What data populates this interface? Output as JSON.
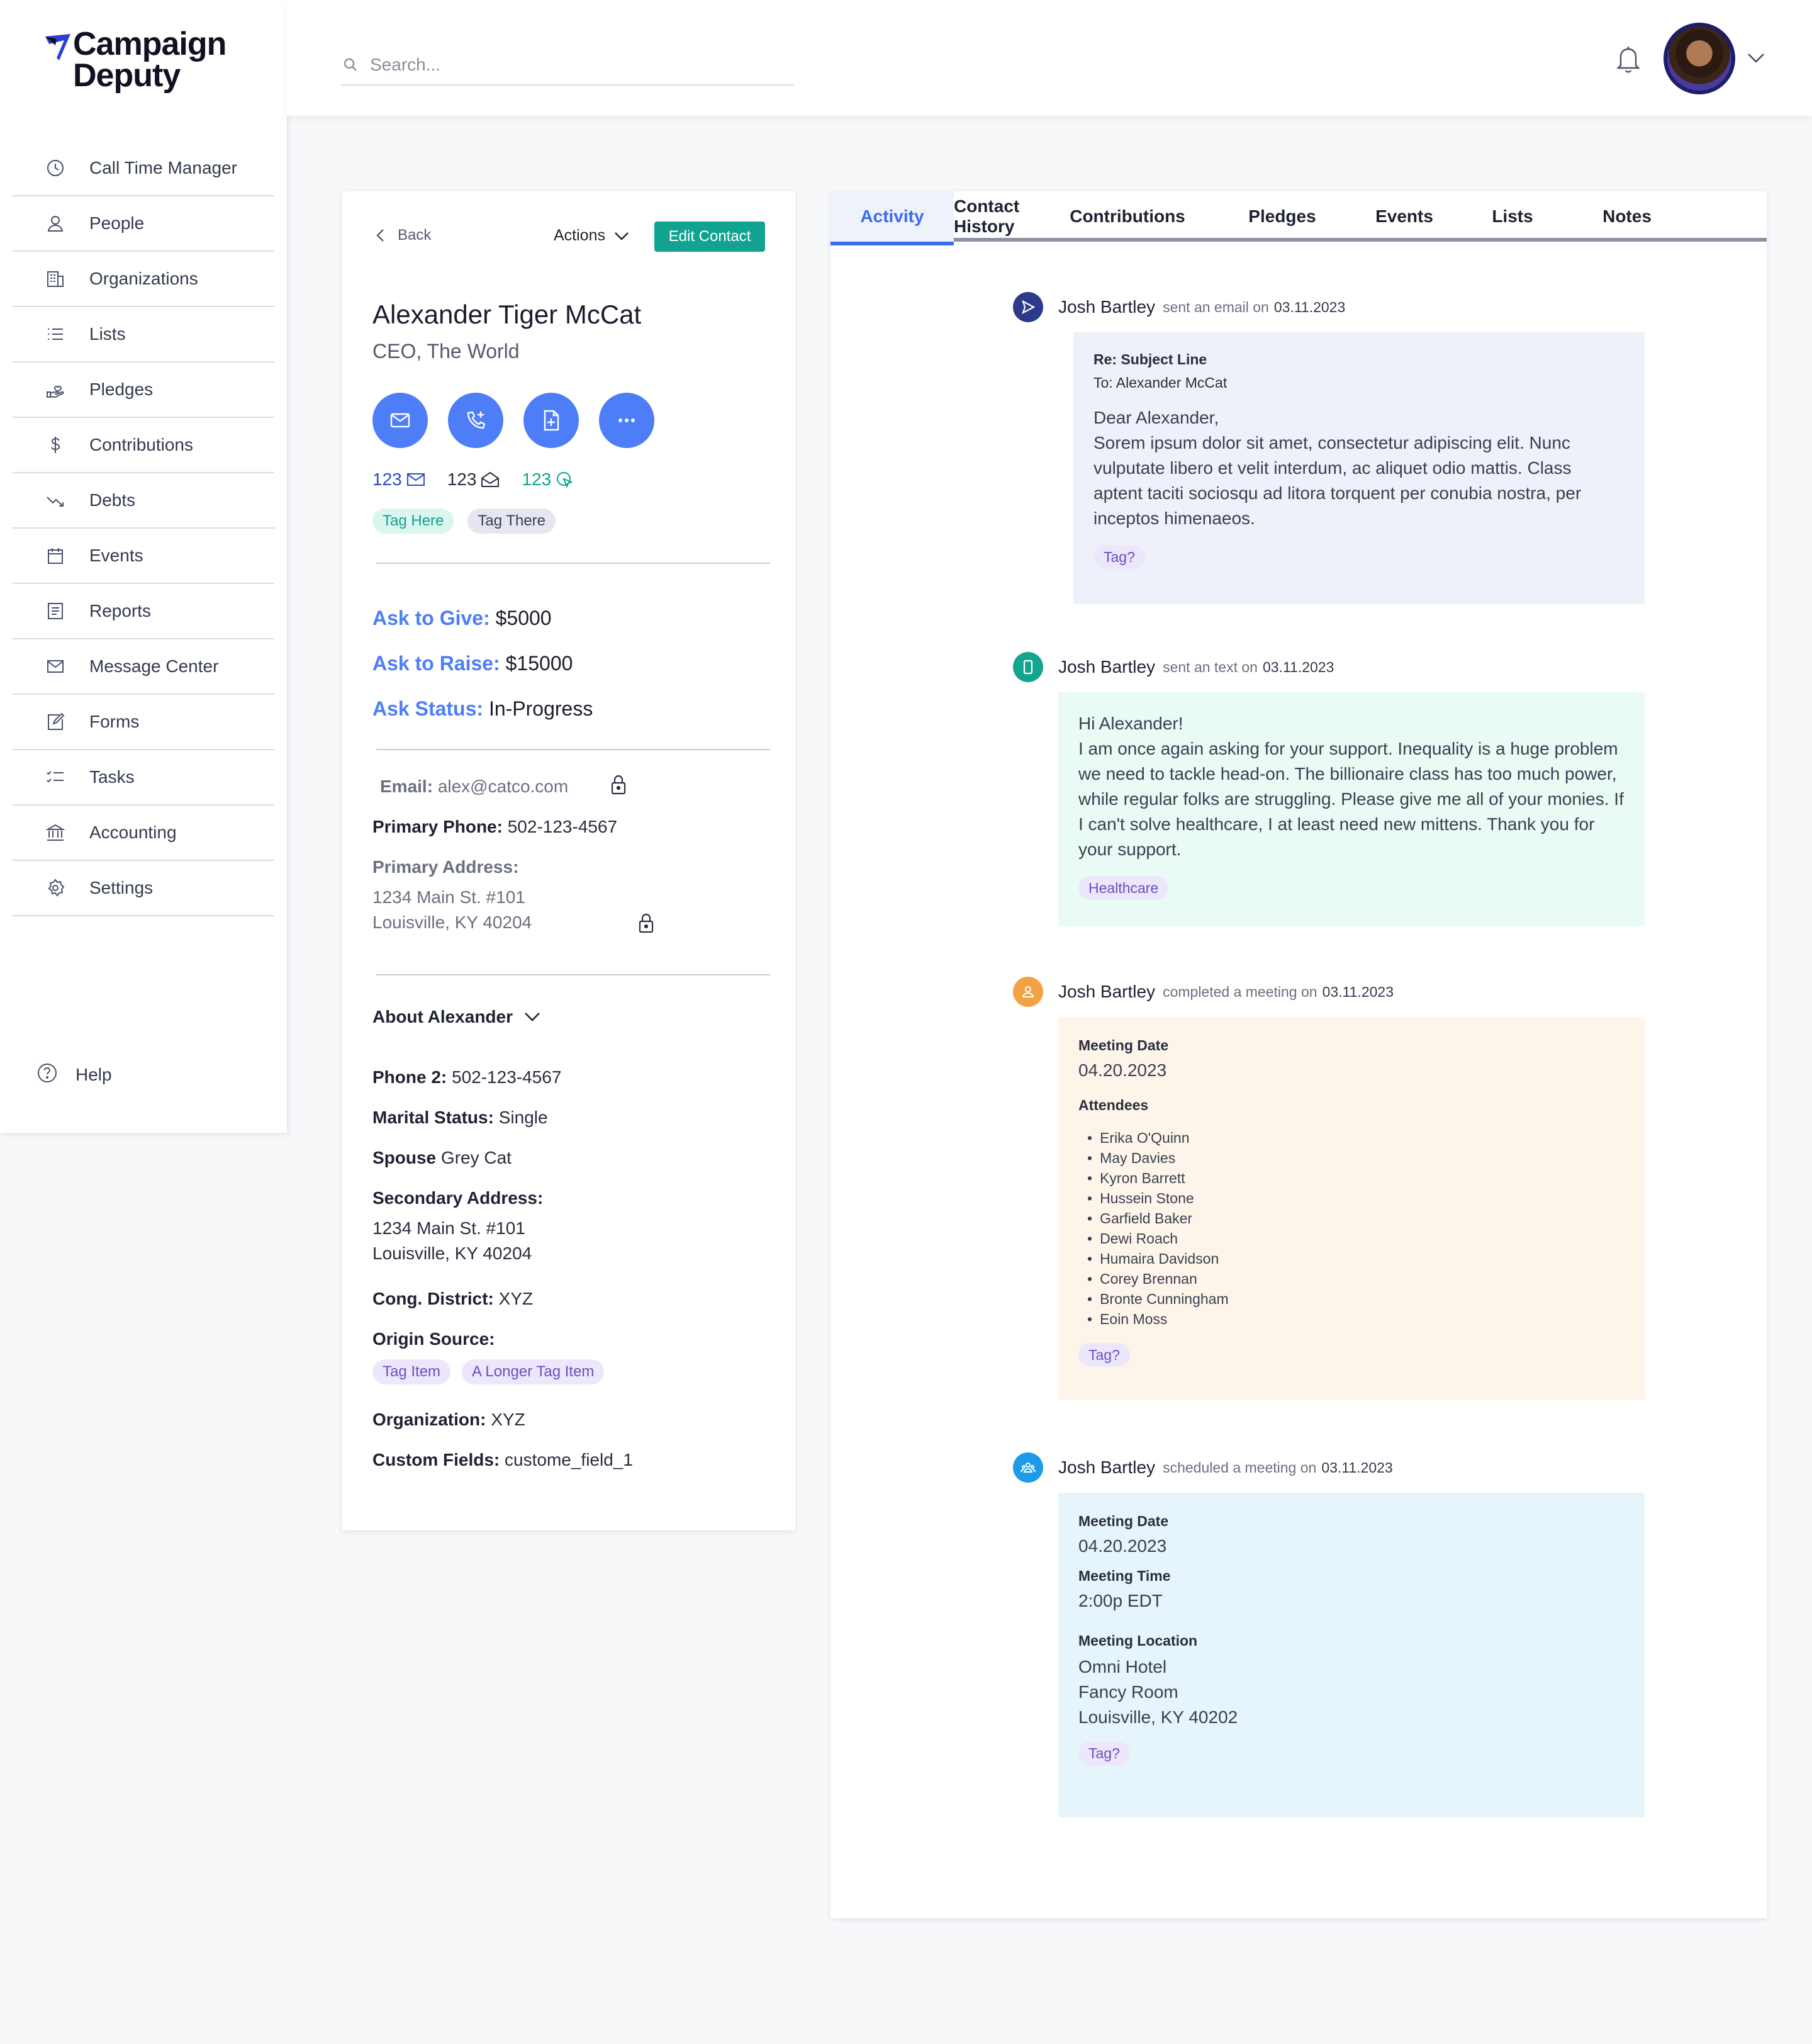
{
  "brand": {
    "line1": "Campaign",
    "line2": "Deputy"
  },
  "sidebar": {
    "items": [
      {
        "label": "Call Time Manager",
        "icon": "clock-icon"
      },
      {
        "label": "People",
        "icon": "person-icon"
      },
      {
        "label": "Organizations",
        "icon": "building-icon"
      },
      {
        "label": "Lists",
        "icon": "list-icon"
      },
      {
        "label": "Pledges",
        "icon": "hand-heart-icon"
      },
      {
        "label": "Contributions",
        "icon": "dollar-icon"
      },
      {
        "label": "Debts",
        "icon": "trend-down-icon"
      },
      {
        "label": "Events",
        "icon": "calendar-icon"
      },
      {
        "label": "Reports",
        "icon": "report-icon"
      },
      {
        "label": "Message Center",
        "icon": "mail-icon"
      },
      {
        "label": "Forms",
        "icon": "edit-form-icon"
      },
      {
        "label": "Tasks",
        "icon": "checklist-icon"
      },
      {
        "label": "Accounting",
        "icon": "bank-icon"
      },
      {
        "label": "Settings",
        "icon": "gear-icon"
      }
    ],
    "help": "Help"
  },
  "header": {
    "search_placeholder": "Search..."
  },
  "contact": {
    "back": "Back",
    "actions": "Actions",
    "edit": "Edit Contact",
    "name": "Alexander Tiger McCat",
    "title": "CEO, The World",
    "counts": {
      "emails": "123",
      "opened": "123",
      "clicked": "123"
    },
    "tags": [
      "Tag Here",
      "Tag There"
    ],
    "ask_give_label": "Ask to Give:",
    "ask_give": "$5000",
    "ask_raise_label": "Ask to Raise:",
    "ask_raise": "$15000",
    "ask_status_label": "Ask Status:",
    "ask_status": "In-Progress",
    "email_label": "Email:",
    "email": "alex@catco.com",
    "phone_label": "Primary Phone:",
    "phone": "502-123-4567",
    "address_label": "Primary Address:",
    "address_line1": "1234 Main St. #101",
    "address_line2": "Louisville, KY 40204",
    "about": "About Alexander",
    "phone2_label": "Phone 2:",
    "phone2": "502-123-4567",
    "marital_label": "Marital Status:",
    "marital": "Single",
    "spouse_label": "Spouse",
    "spouse": "Grey Cat",
    "sec_address_label": "Secondary Address:",
    "sec_address_line1": "1234 Main St. #101",
    "sec_address_line2": "Louisville, KY 40204",
    "district_label": "Cong. District:",
    "district": "XYZ",
    "origin_label": "Origin Source:",
    "origin_tags": [
      "Tag Item",
      "A Longer Tag Item"
    ],
    "org_label": "Organization:",
    "org": "XYZ",
    "custom_label": "Custom Fields:",
    "custom": "custome_field_1"
  },
  "tabs": [
    "Activity",
    "Contact History",
    "Contributions",
    "Pledges",
    "Events",
    "Lists",
    "Notes"
  ],
  "activity": [
    {
      "user": "Josh Bartley",
      "verb": "sent an email on",
      "date": "03.11.2023",
      "subject": "Re: Subject Line",
      "to": "To: Alexander McCat",
      "greeting": "Dear Alexander,",
      "body": "Sorem ipsum dolor sit amet, consectetur adipiscing elit. Nunc vulputate libero et velit interdum, ac aliquet odio mattis. Class aptent taciti sociosqu ad litora torquent per conubia nostra, per inceptos himenaeos.",
      "tag": "Tag?",
      "icon": "send-icon",
      "color": "#2d3a8c"
    },
    {
      "user": "Josh Bartley",
      "verb": "sent an text on",
      "date": "03.11.2023",
      "greeting": "Hi Alexander!",
      "body": "I am once again asking for your support. Inequality is a huge problem we need to tackle head-on. The billionaire class has too much power, while regular folks are struggling. Please give me all of your monies. If I can't solve healthcare, I at least need new mittens. Thank you for your support.",
      "tag": "Healthcare",
      "icon": "phone-icon",
      "color": "#13a58f"
    },
    {
      "user": "Josh Bartley",
      "verb": "completed a meeting on",
      "date": "03.11.2023",
      "date_label": "Meeting Date",
      "meeting_date": "04.20.2023",
      "attendees_label": "Attendees",
      "attendees": [
        "Erika O'Quinn",
        "May Davies",
        "Kyron Barrett",
        "Hussein Stone",
        "Garfield Baker",
        "Dewi Roach",
        "Humaira Davidson",
        "Corey Brennan",
        "Bronte Cunningham",
        "Eoin Moss"
      ],
      "tag": "Tag?",
      "icon": "person-icon",
      "color": "#f2a243"
    },
    {
      "user": "Josh Bartley",
      "verb": "scheduled a meeting on",
      "date": "03.11.2023",
      "date_label": "Meeting Date",
      "meeting_date": "04.20.2023",
      "time_label": "Meeting Time",
      "meeting_time": "2:00p EDT",
      "location_label": "Meeting Location",
      "location_line1": "Omni Hotel",
      "location_line2": "Fancy Room",
      "location_line3": "Louisville, KY 40202",
      "tag": "Tag?",
      "icon": "group-icon",
      "color": "#1e9be8"
    }
  ],
  "colors": {
    "accent": "#4d7ef7",
    "teal": "#11a38f",
    "tab_active": "#3b6bf0"
  }
}
